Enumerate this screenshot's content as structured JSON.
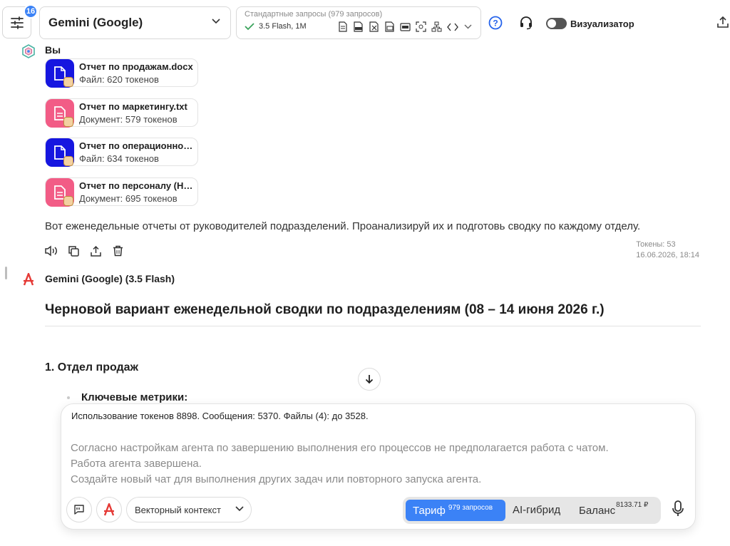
{
  "topbar": {
    "badge_count": "16",
    "model_name": "Gemini (Google)",
    "requests_title": "Стандартные запросы (979 запросов)",
    "requests_model": "3.5 Flash, 1M",
    "visualizer_label": "Визуализатор",
    "visualizer_enabled": false
  },
  "chat": {
    "user_name": "Вы",
    "files": [
      {
        "name": "Отчет по продажам.docx",
        "meta": "Файл: 620 токенов",
        "type": "doc"
      },
      {
        "name": "Отчет по маркетингу.txt",
        "meta": "Документ: 579 токенов",
        "type": "txt"
      },
      {
        "name": "Отчет по операционной …",
        "meta": "Файл: 634 токенов",
        "type": "doc"
      },
      {
        "name": "Отчет по персоналу (HR)…",
        "meta": "Документ: 695 токенов",
        "type": "txt"
      }
    ],
    "user_message": "Вот еженедельные отчеты от руководителей подразделений. Проанализируй их и подготовь сводку по каждому отделу.",
    "tokens_label": "Токены: 53",
    "timestamp": "16.06.2026, 18:14",
    "bot_name": "Gemini (Google) (3.5 Flash)",
    "report_title": "Черновой вариант еженедельной сводки по подразделениям (08 – 14 июня 2026 г.)",
    "section_title": "1. Отдел продаж",
    "bullet_label": "Ключевые метрики:"
  },
  "composer": {
    "usage_text": "Использование токенов 8898. Сообщения: 5370. Файлы (4): до 3528.",
    "notice_lines": [
      "Согласно настройкам агента по завершению выполнения его процессов не предполагается работа с чатом.",
      "Работа агента завершена.",
      "Создайте новый чат для выполнения других задач или повторного запуска агента."
    ],
    "vector_context_label": "Векторный контекст",
    "tariff_label": "Тариф",
    "tariff_sup": "979 запросов",
    "ai_hybrid_label": "AI-гибрид",
    "balance_label": "Баланс",
    "balance_sup": "8133.71 ₽"
  },
  "colors": {
    "accent": "#3b82f6",
    "doc_icon": "#1616e0",
    "txt_icon": "#f25c86",
    "logo_red": "#e53935"
  }
}
